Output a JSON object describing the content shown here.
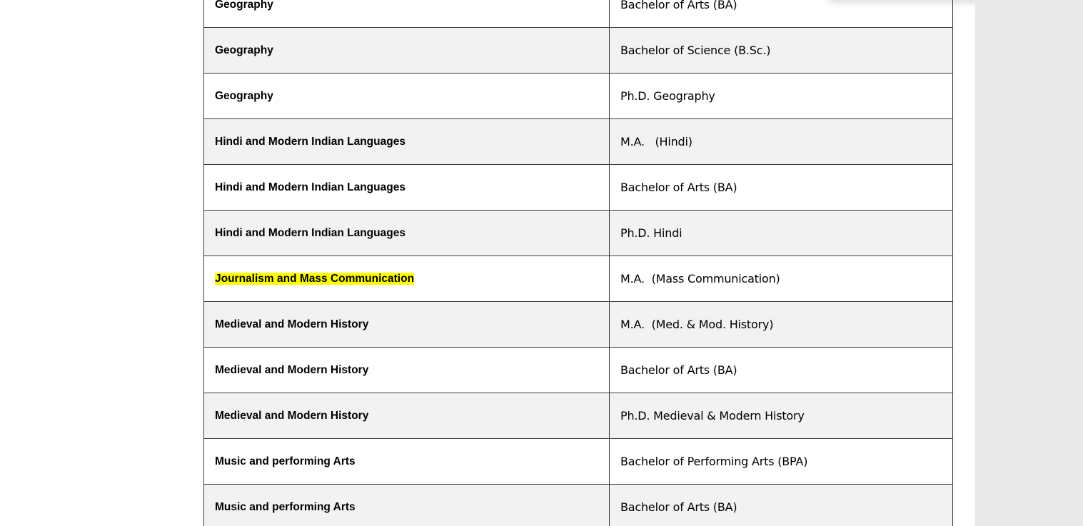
{
  "table": {
    "rows": [
      {
        "department": "Geography",
        "course": "Bachelor of Arts (BA)",
        "highlight": false
      },
      {
        "department": "Geography",
        "course": "Bachelor of Science (B.Sc.)",
        "highlight": false
      },
      {
        "department": "Geography",
        "course": "Ph.D. Geography",
        "highlight": false
      },
      {
        "department": "Hindi and Modern Indian Languages",
        "course": "M.A.   (Hindi)",
        "highlight": false
      },
      {
        "department": "Hindi and Modern Indian Languages",
        "course": "Bachelor of Arts (BA)",
        "highlight": false
      },
      {
        "department": "Hindi and Modern Indian Languages",
        "course": "Ph.D. Hindi",
        "highlight": false
      },
      {
        "department": "Journalism and Mass Communication",
        "course": "M.A.  (Mass Communication)",
        "highlight": true
      },
      {
        "department": "Medieval and Modern History",
        "course": "M.A.  (Med. & Mod. History)",
        "highlight": false
      },
      {
        "department": "Medieval and Modern History",
        "course": "Bachelor of Arts (BA)",
        "highlight": false
      },
      {
        "department": "Medieval and Modern History",
        "course": "Ph.D. Medieval & Modern History",
        "highlight": false
      },
      {
        "department": "Music and performing Arts",
        "course": "Bachelor of Performing Arts (BPA)",
        "highlight": false
      },
      {
        "department": "Music and performing Arts",
        "course": "Bachelor of Arts (BA)",
        "highlight": false
      }
    ]
  },
  "colors": {
    "row_alt": "#f2f2f2",
    "highlight": "#ffff00",
    "border": "#3a3a3a",
    "gutter": "#e9e9e9"
  }
}
